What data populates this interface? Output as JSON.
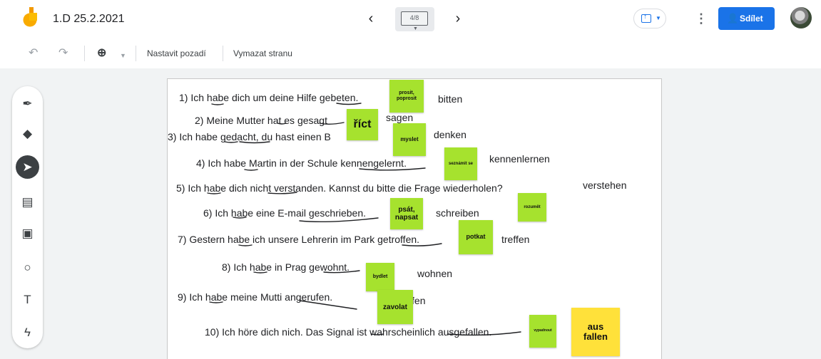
{
  "app": {
    "title": "1.D 25.2.2021",
    "frame_counter": "4/8",
    "share_label": "Sdílet",
    "icons": {
      "logo": "jamboard-logo-icon",
      "prev": "chevron-left-icon",
      "next": "chevron-right-icon",
      "present": "present-icon",
      "more": "more-vert-icon",
      "share": "person-add-icon"
    }
  },
  "toolbar": {
    "undo_icon": "undo-icon",
    "redo_icon": "redo-icon",
    "zoom_icon": "zoom-icon",
    "set_background_label": "Nastavit pozadí",
    "clear_frame_label": "Vymazat stranu"
  },
  "tools": [
    {
      "name": "pen-icon",
      "glyph": "✒"
    },
    {
      "name": "eraser-icon",
      "glyph": "◆"
    },
    {
      "name": "select-icon",
      "glyph": "➤"
    },
    {
      "name": "sticky-note-icon",
      "glyph": "▤"
    },
    {
      "name": "image-icon",
      "glyph": "▣"
    },
    {
      "name": "circle-icon",
      "glyph": "○"
    },
    {
      "name": "text-box-icon",
      "glyph": "T"
    },
    {
      "name": "laser-icon",
      "glyph": "ϟ"
    }
  ],
  "sentences": [
    "1) Ich habe dich um deine Hilfe gebeten.",
    "2) Meine Mutter hat es gesagt",
    "3) Ich habe gedacht, du hast einen B",
    "4) Ich habe Martin in der Schule kennengelernt.",
    "5) Ich habe dich nicht verstanden. Kannst du bitte die Frage wiederholen?",
    "6) Ich habe eine E-mail geschrieben.",
    "7) Gestern habe ich unsere Lehrerin im Park getroffen.",
    "8) Ich habe in Prag gewohnt.",
    "9) Ich habe meine Mutti angerufen.",
    "10) Ich höre dich nich. Das Signal ist wahrscheinlich ausgefallen."
  ],
  "infinitives": [
    "bitten",
    "sagen",
    "denken",
    "kennenlernen",
    "verstehen",
    "schreiben",
    "treffen",
    "wohnen",
    "anrufen"
  ],
  "notes": [
    "prosit, poprosit",
    "říct",
    "myslet",
    "seznámit se",
    "psát, napsat",
    "rozumět",
    "potkat",
    "bydlet",
    "zavolat",
    "vypadnout",
    "aus fallen"
  ],
  "colors": {
    "accent": "#1a73e8",
    "note_green": "#a6e22e",
    "note_yellow": "#ffe13a",
    "logo_orange": "#f9ab00"
  }
}
